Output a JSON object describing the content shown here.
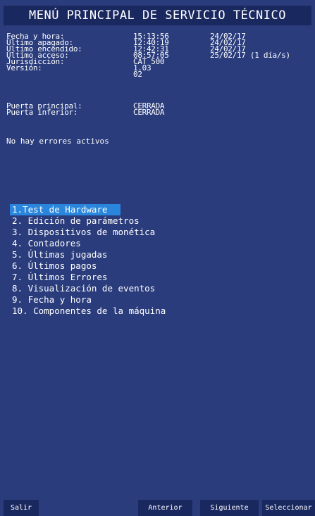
{
  "header": {
    "title": "MENÚ PRINCIPAL DE SERVICIO TÉCNICO"
  },
  "info": {
    "rows": [
      {
        "label": "Fecha y hora:",
        "time": "15:13:56",
        "date": "24/02/17"
      },
      {
        "label": "Último apagado:",
        "time": "12:40:19",
        "date": "24/02/17"
      },
      {
        "label": "Último encendido:",
        "time": "12:42:31",
        "date": "24/02/17"
      },
      {
        "label": "Último acceso:",
        "time": "08:57:05",
        "date": "25/02/17 (1 día/s)"
      },
      {
        "label": "Jurisdicción:",
        "time": "CAT 500",
        "date": ""
      },
      {
        "label": "Versión:",
        "time": "1.03",
        "date": ""
      },
      {
        "label": "",
        "time": "02",
        "date": ""
      }
    ]
  },
  "doors": {
    "rows": [
      {
        "label": "Puerta principal:",
        "value": "CERRADA"
      },
      {
        "label": "Puerta inferior:",
        "value": "CERRADA"
      }
    ]
  },
  "errors": {
    "message": "No hay errores activos"
  },
  "menu": {
    "selected_index": 0,
    "items": [
      "1.Test de Hardware",
      "2. Edición de parámetros",
      "3. Dispositivos de monética",
      "4. Contadores",
      "5. Últimas jugadas",
      "6. Últimos pagos",
      "7. Últimos Errores",
      "8. Visualización de eventos",
      "9. Fecha y hora",
      "10. Componentes de la máquina"
    ]
  },
  "footer": {
    "exit_label": "Salir",
    "prev_label": "Anterior",
    "next_label": "Siguiente",
    "select_label": "Seleccionar"
  }
}
